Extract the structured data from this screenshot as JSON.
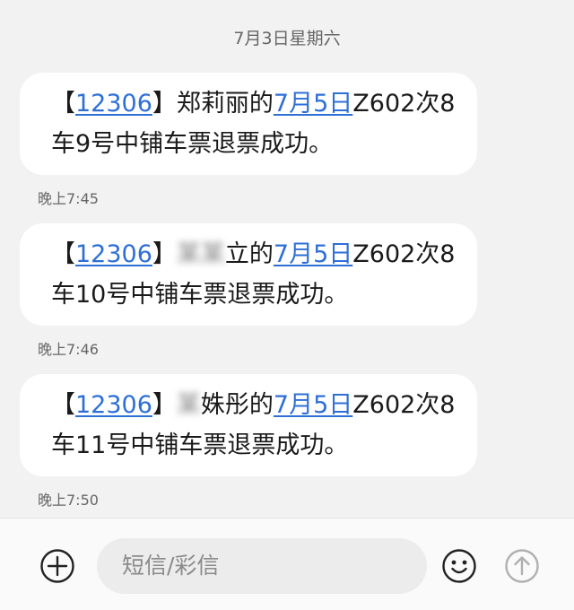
{
  "date_header": "7月3日星期六",
  "messages": [
    {
      "bracket_open": "【",
      "sender_code": "12306",
      "bracket_close": "】",
      "name_clear": "郑莉丽的",
      "date_link": "7月5日",
      "body": "Z602次8车9号中铺车票退票成功。",
      "time": "晚上7:45"
    },
    {
      "bracket_open": "【",
      "sender_code": "12306",
      "bracket_close": "】",
      "name_clear": "立的",
      "date_link": "7月5日",
      "body": "Z602次8车10号中铺车票退票成功。",
      "time": "晚上7:46"
    },
    {
      "bracket_open": "【",
      "sender_code": "12306",
      "bracket_close": "】",
      "name_clear": "姝彤的",
      "date_link": "7月5日",
      "body": "Z602次8车11号中铺车票退票成功。",
      "time": "晚上7:50"
    }
  ],
  "input": {
    "placeholder": "短信/彩信"
  },
  "icons": {
    "add": "plus-circle-icon",
    "emoji": "smiley-icon",
    "send": "arrow-up-circle-icon"
  }
}
